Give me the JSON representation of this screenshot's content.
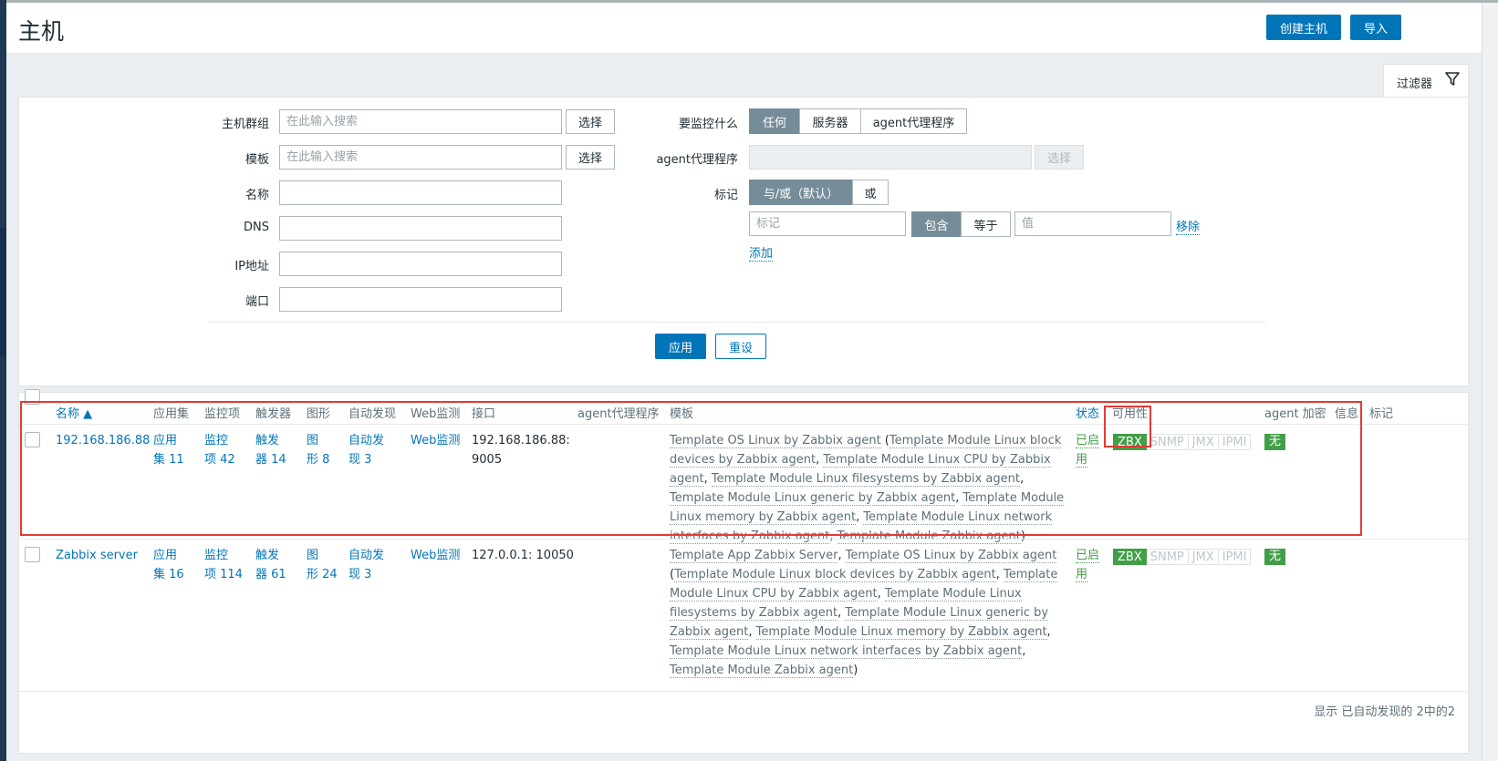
{
  "header": {
    "title": "主机",
    "create_host": "创建主机",
    "import": "导入"
  },
  "filter": {
    "tab_label": "过滤器",
    "host_groups_label": "主机群组",
    "templates_label": "模板",
    "name_label": "名称",
    "dns_label": "DNS",
    "ip_label": "IP地址",
    "port_label": "端口",
    "search_placeholder": "在此输入搜索",
    "select_label": "选择",
    "monitored_by_label": "要监控什么",
    "monitored_by_options": [
      "任何",
      "服务器",
      "agent代理程序"
    ],
    "proxy_label": "agent代理程序",
    "proxy_select_label": "选择",
    "tags_label": "标记",
    "tags_mode_options": [
      "与/或（默认）",
      "或"
    ],
    "tag_placeholder": "标记",
    "tag_operator_options": [
      "包含",
      "等于"
    ],
    "value_placeholder": "值",
    "remove_label": "移除",
    "add_label": "添加",
    "apply_label": "应用",
    "reset_label": "重设"
  },
  "table": {
    "columns": {
      "name": "名称 ▲",
      "applications": "应用集",
      "items": "监控项",
      "triggers": "触发器",
      "graphs": "图形",
      "discovery": "自动发现",
      "web": "Web监测",
      "interface": "接口",
      "proxy": "agent代理程序",
      "templates": "模板",
      "status": "状态",
      "availability": "可用性",
      "encryption": "agent 加密",
      "info": "信息",
      "tags": "标记"
    },
    "rows": [
      {
        "name": "192.168.186.88",
        "apps_line1": "应用",
        "apps_line2": "集 11",
        "items_line1": "监控",
        "items_line2": "项 42",
        "triggers_line1": "触发",
        "triggers_line2": "器 14",
        "graphs_line1": "图",
        "graphs_line2": "形 8",
        "discovery_line1": "自动发",
        "discovery_line2": "现 3",
        "web": "Web监测",
        "interface_line1": "192.168.186.88:",
        "interface_line2": "9005",
        "templates": [
          "Template OS Linux by Zabbix agent",
          "Template Module Linux block devices by Zabbix agent",
          "Template Module Linux CPU by Zabbix agent",
          "Template Module Linux filesystems by Zabbix agent",
          "Template Module Linux generic by Zabbix agent",
          "Template Module Linux memory by Zabbix agent",
          "Template Module Linux network interfaces by Zabbix agent",
          "Template Module Zabbix agent"
        ],
        "status_line1": "已启",
        "status_line2": "用",
        "availability": [
          "ZBX",
          "SNMP",
          "JMX",
          "IPMI"
        ],
        "encryption": "无"
      },
      {
        "name": "Zabbix server",
        "apps_line1": "应用",
        "apps_line2": "集 16",
        "items_line1": "监控",
        "items_line2": "项 114",
        "triggers_line1": "触发",
        "triggers_line2": "器 61",
        "graphs_line1": "图",
        "graphs_line2": "形 24",
        "discovery_line1": "自动发",
        "discovery_line2": "现 3",
        "web": "Web监测",
        "interface_line1": "127.0.0.1: 10050",
        "interface_line2": "",
        "templates": [
          "Template App Zabbix Server",
          "Template OS Linux by Zabbix agent",
          "Template Module Linux block devices by Zabbix agent",
          "Template Module Linux CPU by Zabbix agent",
          "Template Module Linux filesystems by Zabbix agent",
          "Template Module Linux generic by Zabbix agent",
          "Template Module Linux memory by Zabbix agent",
          "Template Module Linux network interfaces by Zabbix agent",
          "Template Module Zabbix agent"
        ],
        "status_line1": "已启",
        "status_line2": "用",
        "availability": [
          "ZBX",
          "SNMP",
          "JMX",
          "IPMI"
        ],
        "encryption": "无"
      }
    ],
    "footer": "显示 已自动发现的 2中的2"
  },
  "colors": {
    "primary": "#0275b8",
    "available": "#429e47",
    "highlight": "#e53935"
  },
  "icons": [
    "filter-icon",
    "sort-asc-icon"
  ]
}
